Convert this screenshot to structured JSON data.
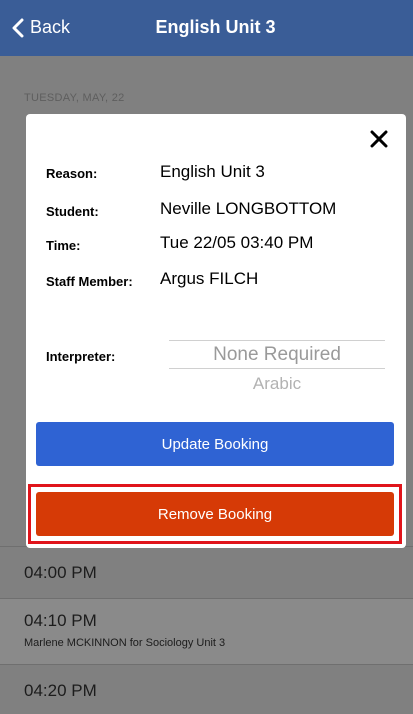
{
  "nav": {
    "back_label": "Back",
    "title": "English Unit 3"
  },
  "background": {
    "date_header": "TUESDAY, MAY, 22",
    "slots": [
      {
        "time": "04:00 PM",
        "detail": ""
      },
      {
        "time": "04:10 PM",
        "detail": "Marlene MCKINNON for Sociology Unit 3"
      },
      {
        "time": "04:20 PM",
        "detail": ""
      }
    ]
  },
  "modal": {
    "fields": [
      {
        "label": "Reason:",
        "value": "English Unit 3"
      },
      {
        "label": "Student:",
        "value": "Neville LONGBOTTOM"
      },
      {
        "label": "Time:",
        "value": "Tue 22/05 03:40 PM"
      },
      {
        "label": "Staff Member:",
        "value": "Argus FILCH"
      }
    ],
    "interpreter": {
      "label": "Interpreter:",
      "options": [
        "None Required",
        "Arabic"
      ]
    },
    "update_label": "Update Booking",
    "remove_label": "Remove Booking"
  },
  "colors": {
    "navbar": "#3a5d97",
    "update_button": "#2f63d3",
    "remove_button": "#d63a06",
    "highlight": "#e0141b"
  }
}
